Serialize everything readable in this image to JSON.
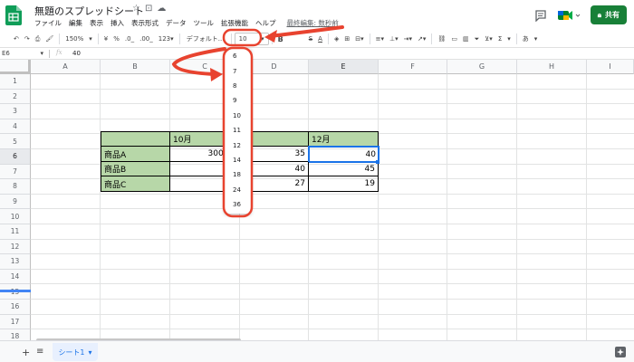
{
  "header": {
    "doc_title": "無題のスプレッドシート",
    "menu": [
      "ファイル",
      "編集",
      "表示",
      "挿入",
      "表示形式",
      "データ",
      "ツール",
      "拡張機能",
      "ヘルプ"
    ],
    "last_edit": "最終編集: 数秒前",
    "share_label": "共有"
  },
  "toolbar": {
    "zoom": "150%",
    "currency": "¥",
    "percent": "%",
    "dec_decrease": ".0_",
    "dec_increase": ".00_",
    "number_format": "123▾",
    "font_family": "デフォルト...",
    "font_size": "10",
    "bold": "B",
    "strike": "S",
    "text_color": "A",
    "sigma": "Σ",
    "input_tools": "あ"
  },
  "formula_bar": {
    "cell_ref": "E6",
    "fx": "fx",
    "value": "40"
  },
  "columns": [
    "A",
    "B",
    "C",
    "D",
    "E",
    "F",
    "G",
    "H",
    "I"
  ],
  "rows": [
    "1",
    "2",
    "3",
    "4",
    "5",
    "6",
    "7",
    "8",
    "9",
    "10",
    "11",
    "12",
    "13",
    "14",
    "15",
    "16",
    "17",
    "18",
    "19"
  ],
  "table": {
    "header": [
      "",
      "10月",
      "11月",
      "12月"
    ],
    "row_labels": [
      "商品A",
      "商品B",
      "商品C"
    ],
    "c_values": [
      "3000.0",
      "",
      ""
    ],
    "d_values": [
      "35",
      "40",
      "27"
    ],
    "e_values": [
      "40",
      "45",
      "19"
    ],
    "d_header_partial": "月"
  },
  "font_size_options": [
    "6",
    "7",
    "8",
    "9",
    "10",
    "11",
    "12",
    "14",
    "18",
    "24",
    "36"
  ],
  "sheet": {
    "tab_label": "シート1"
  }
}
